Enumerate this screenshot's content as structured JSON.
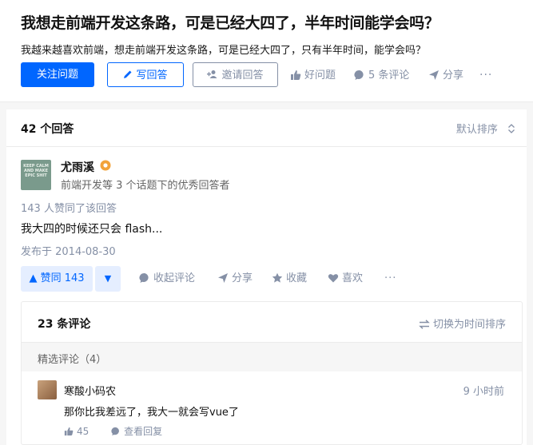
{
  "question": {
    "title": "我想走前端开发这条路，可是已经大四了，半年时间能学会吗？",
    "detail": "我越来越喜欢前端，想走前端开发这条路，可是已经大四了，只有半年时间，能学会吗？",
    "follow_label": "关注问题",
    "write_label": "写回答",
    "invite_label": "邀请回答",
    "good_label": "好问题",
    "comments_label": "5 条评论",
    "share_label": "分享",
    "more_label": "···"
  },
  "answers": {
    "count_label": "42 个回答",
    "sort_label": "默认排序"
  },
  "answer": {
    "avatar_text": "KEEP CALM AND MAKE EPIC SHIT",
    "author": "尤雨溪",
    "author_desc": "前端开发等 3 个话题下的优秀回答者",
    "vote_info": "143 人赞同了该回答",
    "content": "我大四的时候还只会 flash...",
    "published": "发布于 2014-08-30",
    "vote_up_label": "▲ 赞同 143",
    "vote_down_label": "▼",
    "collapse_comments": "收起评论",
    "share": "分享",
    "collect": "收藏",
    "like": "喜欢",
    "more": "···"
  },
  "comments": {
    "count_label": "23 条评论",
    "switch_label": "切换为时间排序",
    "featured_label": "精选评论（4）",
    "items": [
      {
        "user": "寒酸小码农",
        "time": "9 小时前",
        "text": "那你比我差远了，我大一就会写vue了",
        "likes": "45",
        "reply_label": "查看回复"
      }
    ]
  },
  "colors": {
    "accent": "#0066ff",
    "muted": "#8590a6",
    "badge": "#f2a33a"
  }
}
